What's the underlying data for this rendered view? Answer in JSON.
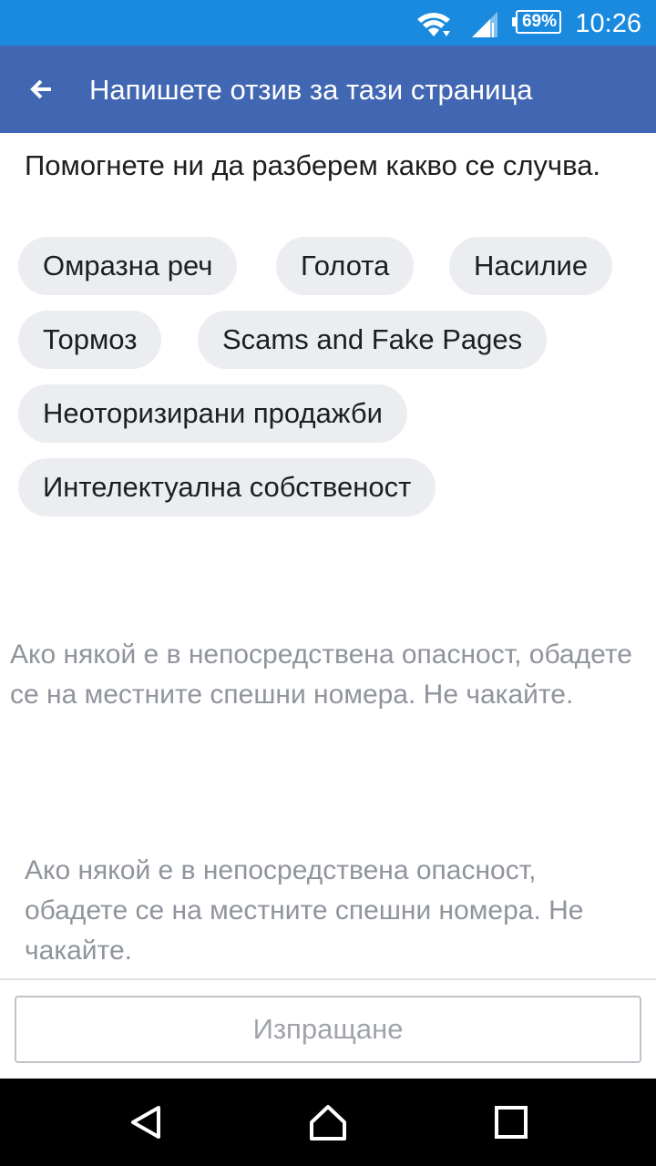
{
  "status_bar": {
    "battery": "69%",
    "time": "10:26",
    "icons": [
      "wifi-icon",
      "signal-icon",
      "battery-icon"
    ]
  },
  "app_bar": {
    "title": "Напишете отзив за тази страница",
    "back_icon": "arrow-left-icon"
  },
  "content": {
    "prompt": "Помогнете ни да разберем какво се случва.",
    "chips": [
      "Омразна реч",
      "Голота",
      "Насилие",
      "Тормоз",
      "Scams and Fake Pages",
      "Неоторизирани продажби",
      "Интелектуална собственост"
    ],
    "warning_1": "Ако някой е в непосредствена опасност, обадете се на местните спешни номера. Не чакайте.",
    "warning_2": "Ако някой е в непосредствена опасност, обадете се на местните спешни номера. Не чакайте."
  },
  "footer": {
    "submit_label": "Изпращане"
  },
  "nav_bar": {
    "icons": [
      "back-triangle-icon",
      "home-icon",
      "recents-icon"
    ]
  },
  "colors": {
    "status_bar": "#1a8adf",
    "app_bar": "#4267b2",
    "chip_bg": "#ebedf0",
    "muted_text": "#90949c"
  }
}
